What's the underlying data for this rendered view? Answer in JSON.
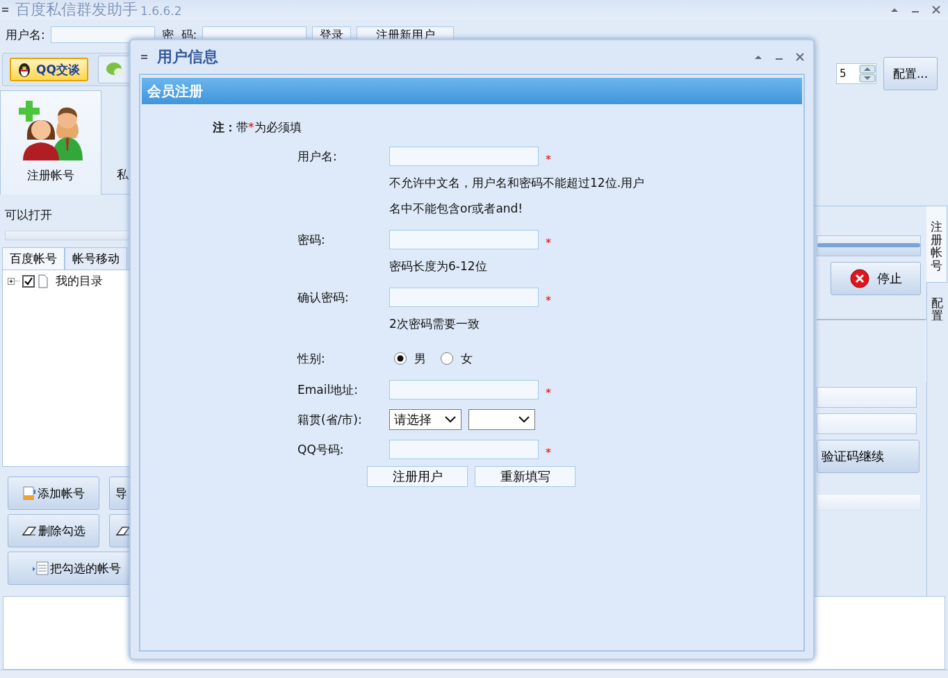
{
  "window": {
    "title": "百度私信群发助手",
    "version": "1.6.6.2"
  },
  "login": {
    "username_label": "用户名:",
    "password_label": "密  码:",
    "login_button": "登录",
    "register_button": "注册新用户"
  },
  "toolbar": [
    {
      "kind": "qq",
      "label": "QQ交谈"
    },
    {
      "kind": "chat"
    }
  ],
  "nav_tabs": [
    {
      "label": "注册帐号",
      "selected": true
    },
    {
      "label": "私",
      "selected": false
    }
  ],
  "status_text": "可以打开",
  "progress": {
    "level": 0
  },
  "account_tabs": [
    {
      "label": "百度帐号",
      "selected": true
    },
    {
      "label": "帐号移动",
      "selected": false
    }
  ],
  "tree": [
    {
      "label": "我的目录",
      "checked": true,
      "expanded": false
    }
  ],
  "left_buttons": [
    {
      "kind": "add",
      "label": "添加帐号"
    },
    {
      "kind": "plain",
      "label": "导"
    },
    {
      "kind": "erase",
      "label": "删除勾选"
    },
    {
      "kind": "erase"
    },
    {
      "kind": "move",
      "label": "把勾选的帐号"
    }
  ],
  "right_panel": {
    "spinner_value": "5",
    "config_button": "配置...",
    "stop_button": "停止",
    "progress": {
      "level": 1
    },
    "continue_button": "验证码继续",
    "side_tabs": [
      {
        "label": "注册帐号",
        "selected": true
      },
      {
        "label": "配置",
        "selected": false
      }
    ]
  },
  "dialog": {
    "title": "用户信息",
    "header": "会员注册",
    "note": {
      "label": "注：",
      "before": "带",
      "mark": "*",
      "after": "为必须填"
    },
    "rows": [
      {
        "kind": "text",
        "label": "用户名:",
        "required": true,
        "hint": "不允许中文名，用户名和密码不能超过12位.用户名中不能包含or或者and!"
      },
      {
        "kind": "text",
        "label": "密码:",
        "required": true,
        "hint": "密码长度为6-12位"
      },
      {
        "kind": "text",
        "label": "确认密码:",
        "required": true,
        "hint": "2次密码需要一致"
      },
      {
        "kind": "radio",
        "label": "性别:",
        "options": [
          {
            "label": "男",
            "selected": true
          },
          {
            "label": "女",
            "selected": false
          }
        ]
      },
      {
        "kind": "text",
        "label": "Email地址:",
        "required": true
      },
      {
        "kind": "select",
        "label": "籍贯(省/市):",
        "selects": [
          {
            "kind": "value",
            "value": "请选择"
          },
          {
            "kind": "blank"
          }
        ]
      },
      {
        "kind": "text",
        "label": "QQ号码:",
        "required": true
      }
    ],
    "buttons": [
      "注册用户",
      "重新填写"
    ]
  }
}
